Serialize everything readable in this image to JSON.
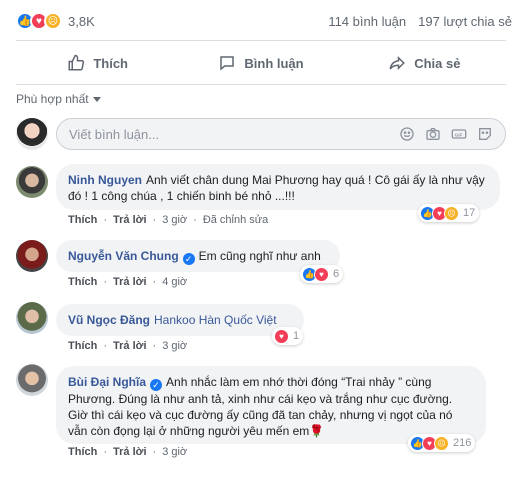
{
  "post": {
    "reaction_count": "3,8K",
    "comment_count": "114 bình luận",
    "share_count": "197 lượt chia sẻ"
  },
  "actions": {
    "like": "Thích",
    "comment": "Bình luận",
    "share": "Chia sẻ"
  },
  "sort_label": "Phù hợp nhất",
  "composer": {
    "placeholder": "Viết bình luận..."
  },
  "comments": [
    {
      "author": "Ninh Nguyen",
      "text": "Anh viết chân dung Mai Phương hay quá ! Cô gái ấy là như vậy đó ! 1 công chúa , 1 chiến binh bé nhỏ ...!!!",
      "like": "Thích",
      "reply": "Trả lời",
      "time": "3 giờ",
      "edited": "Đã chỉnh sửa",
      "reactions": "17"
    },
    {
      "author": "Nguyễn Văn Chung",
      "text": "Em cũng nghĩ như anh",
      "like": "Thích",
      "reply": "Trả lời",
      "time": "4 giờ",
      "reactions": "6"
    },
    {
      "author": "Vũ Ngọc Đăng",
      "mention": "Hankoo Hàn Quốc Việt",
      "like": "Thích",
      "reply": "Trả lời",
      "time": "3 giờ",
      "reactions": "1"
    },
    {
      "author": "Bùi Đại Nghĩa",
      "text": "Anh nhắc làm em nhớ thời đóng “Trai nhảy ” cùng Phương. Đúng là như anh tả, xinh như cái kẹo và trắng như cục đường. Giờ thì cái kẹo và cục đường ấy cũng đã tan chảy, nhưng vị ngọt của nó vẫn còn đọng lại ở những người yêu mến em🌹",
      "like": "Thích",
      "reply": "Trả lời",
      "time": "3 giờ",
      "reactions": "216"
    }
  ],
  "colors": {
    "accent": "#1877f2",
    "love": "#f33e58",
    "sad": "#f7b125",
    "author": "#385898"
  }
}
